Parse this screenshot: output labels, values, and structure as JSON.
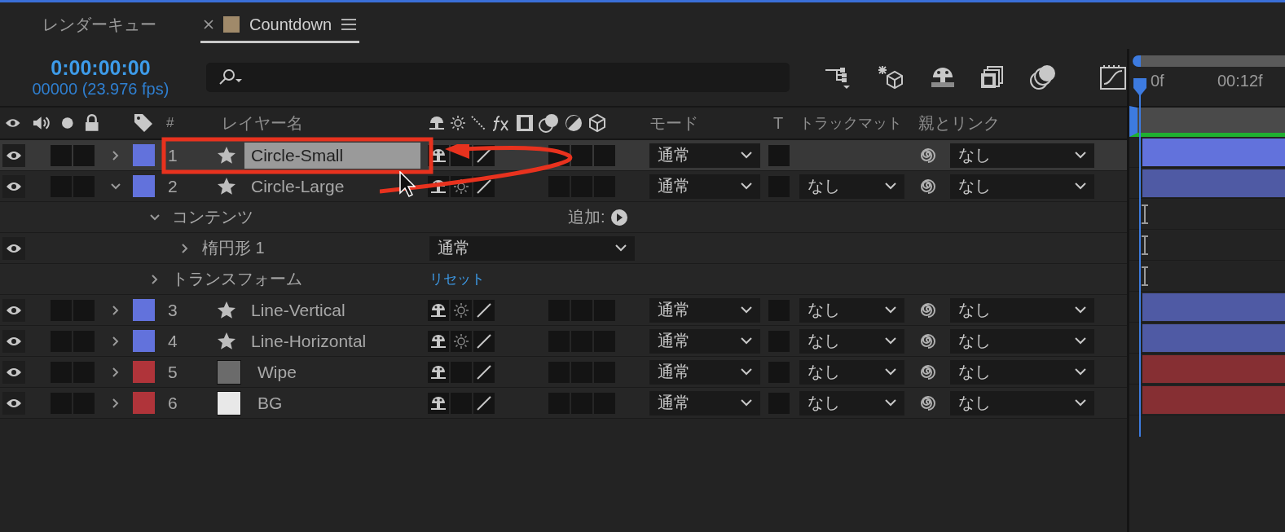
{
  "tabs": [
    {
      "label": "レンダーキュー",
      "selected": false
    },
    {
      "label": "Countdown",
      "selected": true,
      "color": "#a08a6a"
    }
  ],
  "timecode": "0:00:00:00",
  "frame_info": "00000 (23.976 fps)",
  "header": {
    "number": "#",
    "layer_name": "レイヤー名",
    "mode": "モード",
    "t": "T",
    "track_matte": "トラックマット",
    "parent": "親とリンク"
  },
  "timeline": {
    "ticks": [
      "0f",
      "00:12f"
    ]
  },
  "layers": [
    {
      "kind": "shape_layer",
      "number": "1",
      "name": "Circle-Small",
      "color": "#6272dc",
      "selected": true,
      "expanded": false,
      "visible": true,
      "raster": false,
      "mode": "通常",
      "parent": "なし"
    },
    {
      "kind": "shape_layer",
      "number": "2",
      "name": "Circle-Large",
      "color": "#6272dc",
      "selected": false,
      "expanded": true,
      "visible": true,
      "raster": true,
      "mode": "通常",
      "track_matte": "なし",
      "parent": "なし",
      "children": [
        {
          "kind": "group",
          "name": "コンテンツ",
          "expanded": true,
          "action": "追加:",
          "children": [
            {
              "kind": "shape",
              "name": "楕円形 1",
              "expanded": false,
              "visible": true,
              "mode": "通常"
            }
          ]
        },
        {
          "kind": "property",
          "name": "トランスフォーム",
          "expanded": false,
          "action": "リセット"
        }
      ]
    },
    {
      "kind": "shape_layer",
      "number": "3",
      "name": "Line-Vertical",
      "color": "#6272dc",
      "selected": false,
      "expanded": false,
      "visible": true,
      "raster": true,
      "mode": "通常",
      "track_matte": "なし",
      "parent": "なし"
    },
    {
      "kind": "shape_layer",
      "number": "4",
      "name": "Line-Horizontal",
      "color": "#6272dc",
      "selected": false,
      "expanded": false,
      "visible": true,
      "raster": true,
      "mode": "通常",
      "track_matte": "なし",
      "parent": "なし"
    },
    {
      "kind": "solid_layer",
      "number": "5",
      "name": "Wipe",
      "thumbnail": {
        "color": "#6b6b6b"
      },
      "color": "#b0343a",
      "selected": false,
      "expanded": false,
      "visible": true,
      "raster": false,
      "mode": "通常",
      "track_matte": "なし",
      "parent": "なし"
    },
    {
      "kind": "solid_layer",
      "number": "6",
      "name": "BG",
      "thumbnail": {
        "color": "#e8e8e8"
      },
      "color": "#b0343a",
      "selected": false,
      "expanded": false,
      "visible": true,
      "raster": false,
      "mode": "通常",
      "track_matte": "なし",
      "parent": "なし"
    }
  ]
}
